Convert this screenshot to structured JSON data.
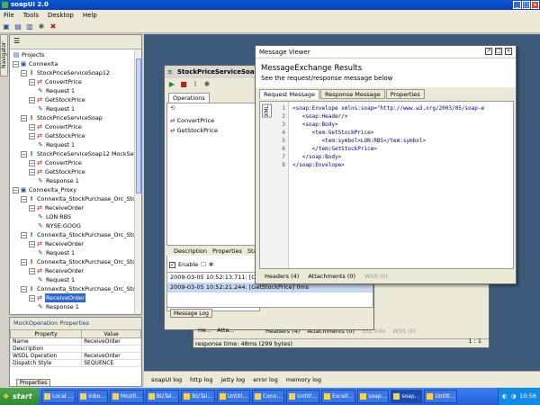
{
  "window": {
    "title": "soapUI 2.0"
  },
  "menu": [
    "File",
    "Tools",
    "Desktop",
    "Help"
  ],
  "navigator": {
    "tab_label": "Navigator",
    "tree": [
      {
        "label": "Projects",
        "icon": "folder-icon",
        "level": 0
      },
      {
        "label": "Connexita",
        "icon": "project-icon",
        "level": 0
      },
      {
        "label": "StockPriceServiceSoap12",
        "icon": "interface-icon",
        "level": 1
      },
      {
        "label": "ConvertPrice",
        "icon": "operation-icon",
        "level": 2
      },
      {
        "label": "Request 1",
        "icon": "request-icon",
        "level": 3
      },
      {
        "label": "GetStockPrice",
        "icon": "operation-icon",
        "level": 2
      },
      {
        "label": "Request 1",
        "icon": "request-icon",
        "level": 3
      },
      {
        "label": "StockPriceServiceSoap",
        "icon": "interface-icon",
        "level": 1
      },
      {
        "label": "ConvertPrice",
        "icon": "operation-icon",
        "level": 2
      },
      {
        "label": "GetStockPrice",
        "icon": "operation-icon",
        "level": 2
      },
      {
        "label": "Request 1",
        "icon": "request-icon",
        "level": 3
      },
      {
        "label": "StockPriceServiceSoap12 MockServ",
        "icon": "mockservice-icon",
        "level": 1
      },
      {
        "label": "ConvertPrice",
        "icon": "operation-icon",
        "level": 2
      },
      {
        "label": "GetStockPrice",
        "icon": "operation-icon",
        "level": 2
      },
      {
        "label": "Response 1",
        "icon": "request-icon",
        "level": 3
      },
      {
        "label": "Connexita_Proxy",
        "icon": "project-icon",
        "level": 0
      },
      {
        "label": "Connexita_StockPurchase_Orc_Sto",
        "icon": "interface-icon",
        "level": 1
      },
      {
        "label": "ReceiveOrder",
        "icon": "operation-icon",
        "level": 2
      },
      {
        "label": "LON:RBS",
        "icon": "request-icon",
        "level": 3
      },
      {
        "label": "NYSE:GOOG",
        "icon": "request-icon",
        "level": 3
      },
      {
        "label": "Connexita_StockPurchase_Orc_Sto",
        "icon": "interface-icon",
        "level": 1
      },
      {
        "label": "ReceiveOrder",
        "icon": "operation-icon",
        "level": 2
      },
      {
        "label": "Request 1",
        "icon": "request-icon",
        "level": 3
      },
      {
        "label": "Connexita_StockPurchase_Orc_Sto",
        "icon": "interface-icon",
        "level": 1
      },
      {
        "label": "ReceiveOrder",
        "icon": "operation-icon",
        "level": 2
      },
      {
        "label": "Request 1",
        "icon": "request-icon",
        "level": 3
      },
      {
        "label": "Connexita_StockPurchase_Orc_Sto",
        "icon": "interface-icon",
        "level": 1
      },
      {
        "label": "ReceiveOrder",
        "icon": "operation-icon",
        "level": 2,
        "selected": true
      },
      {
        "label": "Response 1",
        "icon": "request-icon",
        "level": 3
      }
    ]
  },
  "properties": {
    "title": "MockOperation Properties",
    "headers": [
      "Property",
      "Value"
    ],
    "rows": [
      [
        "Name",
        "ReceiveOrder"
      ],
      [
        "Description",
        ""
      ],
      [
        "WSDL Operation",
        "ReceiveOrder"
      ],
      [
        "Dispatch Style",
        "SEQUENCE"
      ]
    ],
    "tab_label": "Properties"
  },
  "service_window": {
    "title": "StockPriceServiceSoap12",
    "ops_tab": "Operations",
    "operations": [
      "ConvertPrice",
      "GetStockPrice"
    ],
    "bottom_tabs": [
      "Description",
      "Properties",
      "Start"
    ],
    "enable_label": "Enable",
    "log_rows": [
      "2009-03-05 10:52:13.711: [Conve",
      "2009-03-05 10:52:21.244: [GetStockPrice] 0ms"
    ],
    "message_log_tab": "Message Log"
  },
  "request_window": {
    "tabs": [
      "He...",
      "Atta...",
      "Headers (4)",
      "Attachments (0)",
      "SSL Info",
      "WSS (0)"
    ],
    "status": "response time: 48ms (299 bytes)",
    "pager": "1 : 1",
    "resp_label": "resp"
  },
  "message_viewer": {
    "title": "Message Viewer",
    "heading": "MessageExchange Results",
    "subheading": "See the request/response message below",
    "tabs": [
      "Request Message",
      "Response Message",
      "Properties"
    ],
    "xml_label": "XML",
    "lines": [
      {
        "n": "1",
        "code": "<soap:Envelope xmlns:soap=\"http://www.w3.org/2003/05/soap-e"
      },
      {
        "n": "2",
        "code": "   <soap:Header/>"
      },
      {
        "n": "3",
        "code": "   <soap:Body>"
      },
      {
        "n": "4",
        "code": "      <tem:GetStockPrice>"
      },
      {
        "n": "5",
        "code": "         <tem:symbol>LON:RBS</tem:symbol>"
      },
      {
        "n": "6",
        "code": "      </tem:GetStockPrice>"
      },
      {
        "n": "7",
        "code": "   </soap:Body>"
      },
      {
        "n": "8",
        "code": "</soap:Envelope>"
      }
    ],
    "footer": [
      "Headers (4)",
      "Attachments (0)",
      "WSS (0)"
    ]
  },
  "log_tabs": [
    "soapUI log",
    "http log",
    "jetty log",
    "error log",
    "memory log"
  ],
  "taskbar": {
    "start": "start",
    "tasks": [
      "Local ...",
      "Inbo...",
      "Mozill...",
      "BizTal...",
      "BizTal...",
      "Untitl...",
      "Conn...",
      "Untitl...",
      "Excell...",
      "soap...",
      "soap...",
      "Untitl..."
    ],
    "active_index": 10,
    "clock": "10:56"
  }
}
